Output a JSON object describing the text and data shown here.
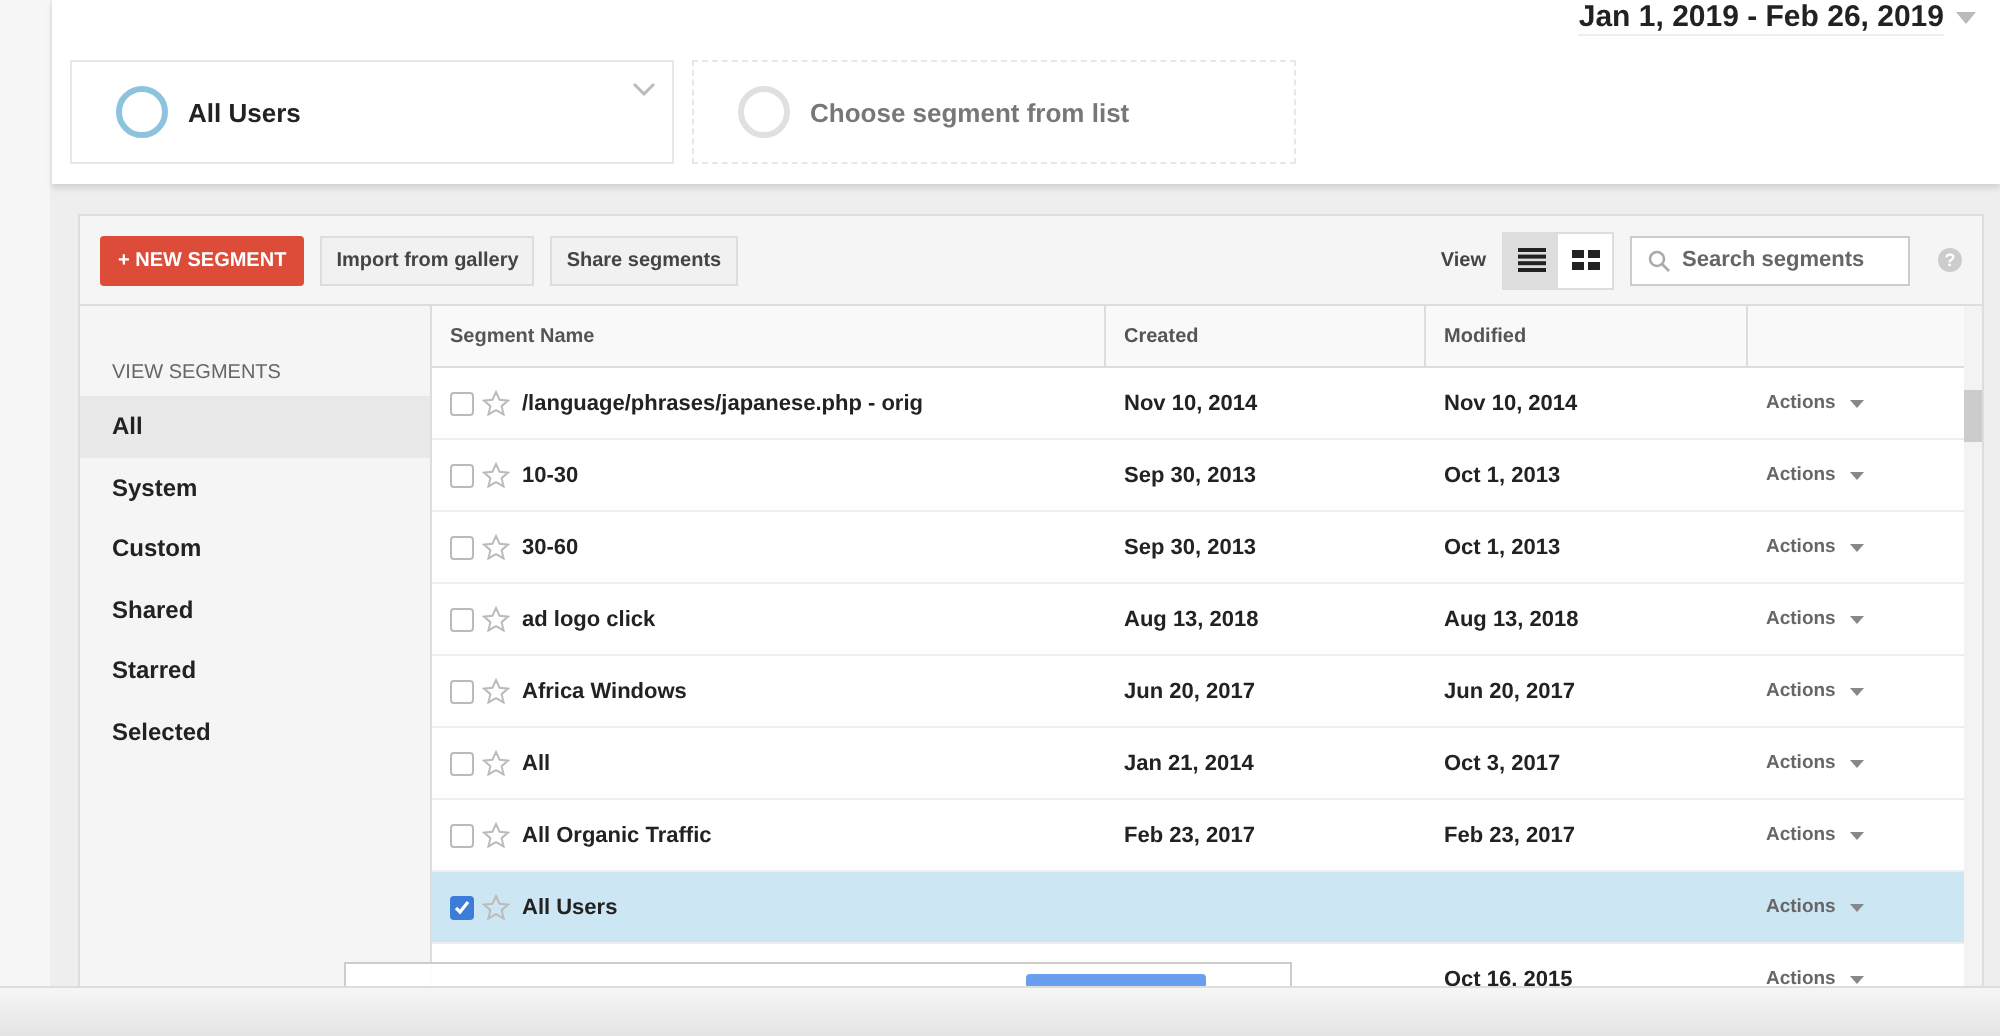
{
  "date_range": "Jan 1, 2019 - Feb 26, 2019",
  "segment_slots": [
    {
      "label": "All Users",
      "filled": true
    },
    {
      "label": "Choose segment from list",
      "filled": false
    }
  ],
  "toolbar": {
    "new_button": "+ NEW SEGMENT",
    "buttons": [
      "Import from gallery",
      "Share segments"
    ],
    "view_label": "View",
    "views": [
      {
        "kind": "list",
        "selected": true
      },
      {
        "kind": "grid",
        "selected": false
      }
    ],
    "search": {
      "placeholder": "Search segments"
    },
    "help": "?"
  },
  "sidebar": {
    "heading": "VIEW SEGMENTS",
    "items": [
      {
        "label": "All",
        "selected": true
      },
      {
        "label": "System",
        "selected": false
      },
      {
        "label": "Custom",
        "selected": false
      },
      {
        "label": "Shared",
        "selected": false
      },
      {
        "label": "Starred",
        "selected": false
      },
      {
        "label": "Selected",
        "selected": false
      }
    ]
  },
  "table": {
    "columns": [
      "Segment Name",
      "Created",
      "Modified"
    ],
    "rows": [
      {
        "name": "/language/phrases/japanese.php - orig",
        "created": "Nov 10, 2014",
        "modified": "Nov 10, 2014",
        "actions": "Actions",
        "checked": false,
        "starred": false
      },
      {
        "name": "10-30",
        "created": "Sep 30, 2013",
        "modified": "Oct 1, 2013",
        "actions": "Actions",
        "checked": false,
        "starred": false
      },
      {
        "name": "30-60",
        "created": "Sep 30, 2013",
        "modified": "Oct 1, 2013",
        "actions": "Actions",
        "checked": false,
        "starred": false
      },
      {
        "name": "ad logo click",
        "created": "Aug 13, 2018",
        "modified": "Aug 13, 2018",
        "actions": "Actions",
        "checked": false,
        "starred": false
      },
      {
        "name": "Africa Windows",
        "created": "Jun 20, 2017",
        "modified": "Jun 20, 2017",
        "actions": "Actions",
        "checked": false,
        "starred": false
      },
      {
        "name": "All",
        "created": "Jan 21, 2014",
        "modified": "Oct 3, 2017",
        "actions": "Actions",
        "checked": false,
        "starred": false
      },
      {
        "name": "All Organic Traffic",
        "created": "Feb 23, 2017",
        "modified": "Feb 23, 2017",
        "actions": "Actions",
        "checked": false,
        "starred": false
      },
      {
        "name": "All Users",
        "actions": "Actions",
        "checked": true,
        "starred": false
      },
      {
        "modified": "Oct 16, 2015",
        "actions": "Actions"
      }
    ]
  }
}
